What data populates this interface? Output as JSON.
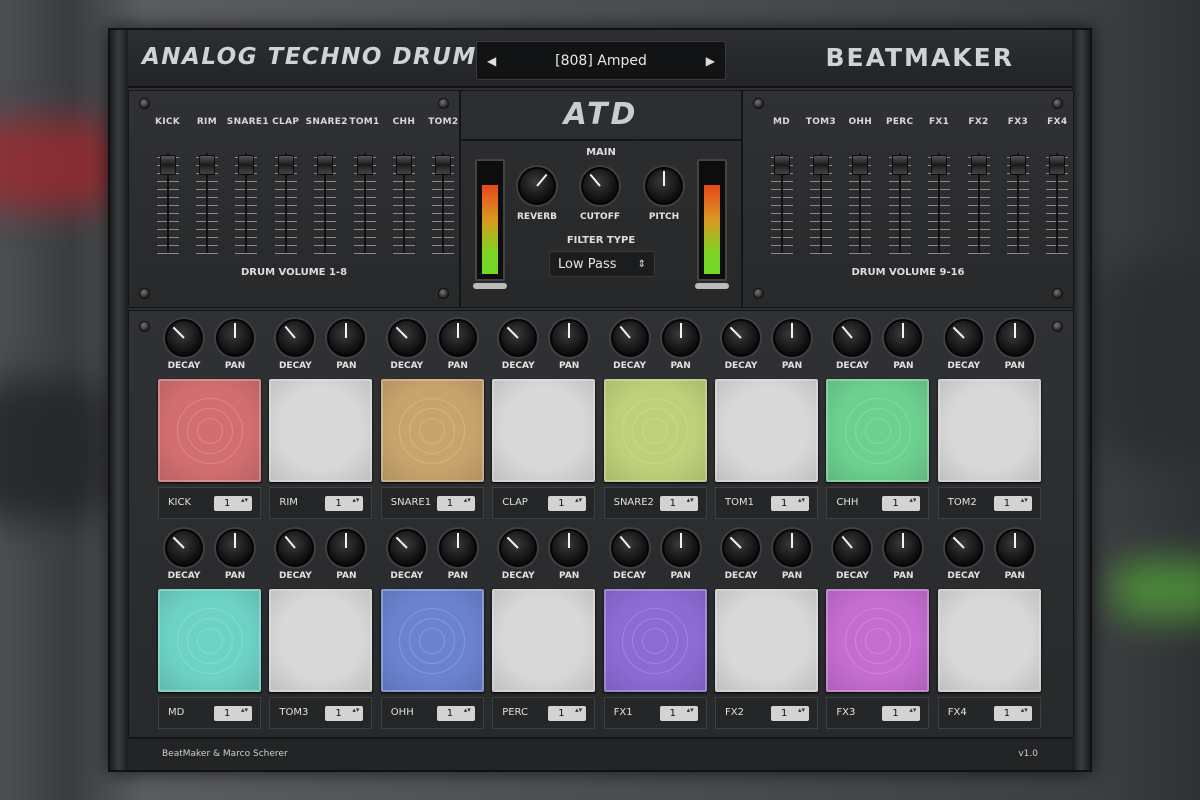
{
  "title_left": "ANALOG TECHNO DRUMS",
  "title_right": "BEATMAKER",
  "preset": {
    "name": "[808] Amped",
    "prev": "◀",
    "next": "▶"
  },
  "center_logo": "ATD",
  "volumes_left": {
    "group_label": "DRUM VOLUME 1-8",
    "channels": [
      "KICK",
      "RIM",
      "SNARE1",
      "CLAP",
      "SNARE2",
      "TOM1",
      "CHH",
      "TOM2"
    ]
  },
  "volumes_right": {
    "group_label": "DRUM VOLUME 9-16",
    "channels": [
      "MD",
      "TOM3",
      "OHH",
      "PERC",
      "FX1",
      "FX2",
      "FX3",
      "FX4"
    ]
  },
  "main": {
    "label": "MAIN",
    "reverb": "REVERB",
    "cutoff": "CUTOFF",
    "pitch": "PITCH",
    "filter_label": "FILTER TYPE",
    "filter_value": "Low Pass",
    "filter_arrows": "⇕"
  },
  "knob_labels": {
    "decay": "DECAY",
    "pan": "PAN"
  },
  "pads_row1": [
    {
      "name": "KICK",
      "channel": "1",
      "color": "#d26e70"
    },
    {
      "name": "RIM",
      "channel": "1",
      "color": "#d8d8d8"
    },
    {
      "name": "SNARE1",
      "channel": "1",
      "color": "#c8a46d"
    },
    {
      "name": "CLAP",
      "channel": "1",
      "color": "#d8d8d8"
    },
    {
      "name": "SNARE2",
      "channel": "1",
      "color": "#bfd07a"
    },
    {
      "name": "TOM1",
      "channel": "1",
      "color": "#d8d8d8"
    },
    {
      "name": "CHH",
      "channel": "1",
      "color": "#6cd08f"
    },
    {
      "name": "TOM2",
      "channel": "1",
      "color": "#d8d8d8"
    }
  ],
  "pads_row2": [
    {
      "name": "MD",
      "channel": "1",
      "color": "#6cd2c4"
    },
    {
      "name": "TOM3",
      "channel": "1",
      "color": "#d8d8d8"
    },
    {
      "name": "OHH",
      "channel": "1",
      "color": "#6a83cf"
    },
    {
      "name": "PERC",
      "channel": "1",
      "color": "#d8d8d8"
    },
    {
      "name": "FX1",
      "channel": "1",
      "color": "#8d6bd4"
    },
    {
      "name": "FX2",
      "channel": "1",
      "color": "#d8d8d8"
    },
    {
      "name": "FX3",
      "channel": "1",
      "color": "#c46cd0"
    },
    {
      "name": "FX4",
      "channel": "1",
      "color": "#d8d8d8"
    }
  ],
  "spinner_arrows": "▴▾",
  "footer": {
    "credit": "BeatMaker & Marco Scherer",
    "version": "v1.0"
  }
}
